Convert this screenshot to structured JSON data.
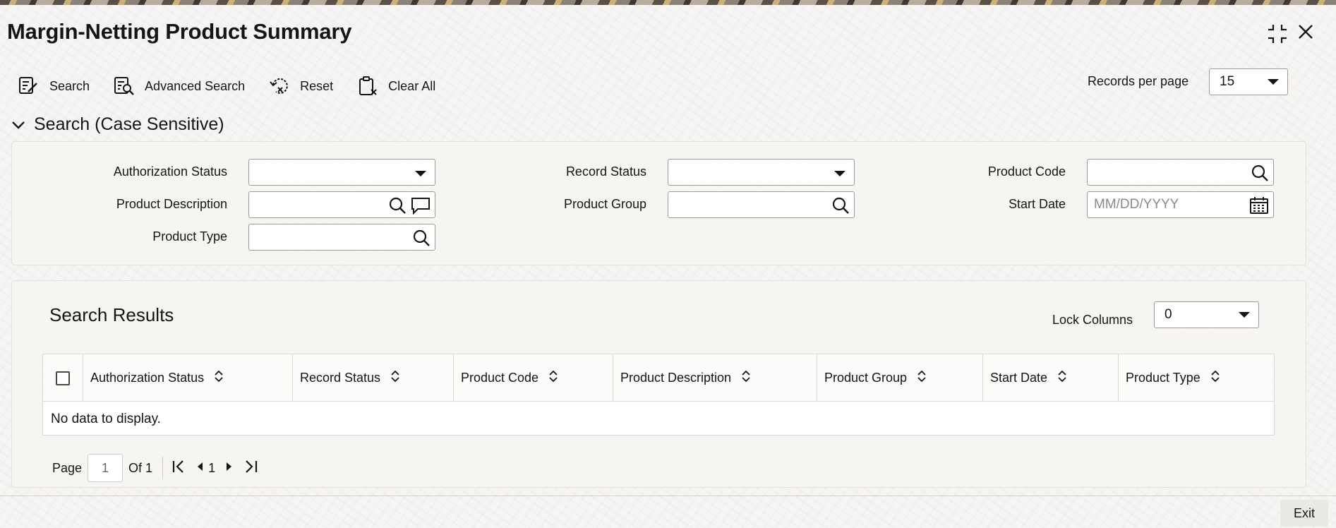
{
  "window": {
    "title": "Margin-Netting Product Summary"
  },
  "toolbar": {
    "search_label": "Search",
    "advanced_search_label": "Advanced Search",
    "reset_label": "Reset",
    "clear_all_label": "Clear All",
    "records_per_page_label": "Records per page",
    "records_per_page_value": "15"
  },
  "search_section": {
    "heading": "Search (Case Sensitive)",
    "fields": {
      "authorization_status": {
        "label": "Authorization Status",
        "value": ""
      },
      "record_status": {
        "label": "Record Status",
        "value": ""
      },
      "product_code": {
        "label": "Product Code",
        "value": ""
      },
      "product_description": {
        "label": "Product Description",
        "value": ""
      },
      "product_group": {
        "label": "Product Group",
        "value": ""
      },
      "start_date": {
        "label": "Start Date",
        "placeholder": "MM/DD/YYYY"
      },
      "product_type": {
        "label": "Product Type",
        "value": ""
      }
    }
  },
  "results": {
    "title": "Search Results",
    "lock_columns_label": "Lock Columns",
    "lock_columns_value": "0",
    "columns": [
      "Authorization Status",
      "Record Status",
      "Product Code",
      "Product Description",
      "Product Group",
      "Start Date",
      "Product Type"
    ],
    "rows": [],
    "empty_message": "No data to display."
  },
  "pagination": {
    "page_label": "Page",
    "page_value": "1",
    "of_label": "Of 1",
    "current_page": "1"
  },
  "footer": {
    "exit_label": "Exit"
  },
  "icons": {
    "search": "search-icon",
    "comment": "comment-icon",
    "calendar": "calendar-icon",
    "sort": "sort-icon",
    "minimize": "minimize-icon",
    "close": "close-icon"
  }
}
